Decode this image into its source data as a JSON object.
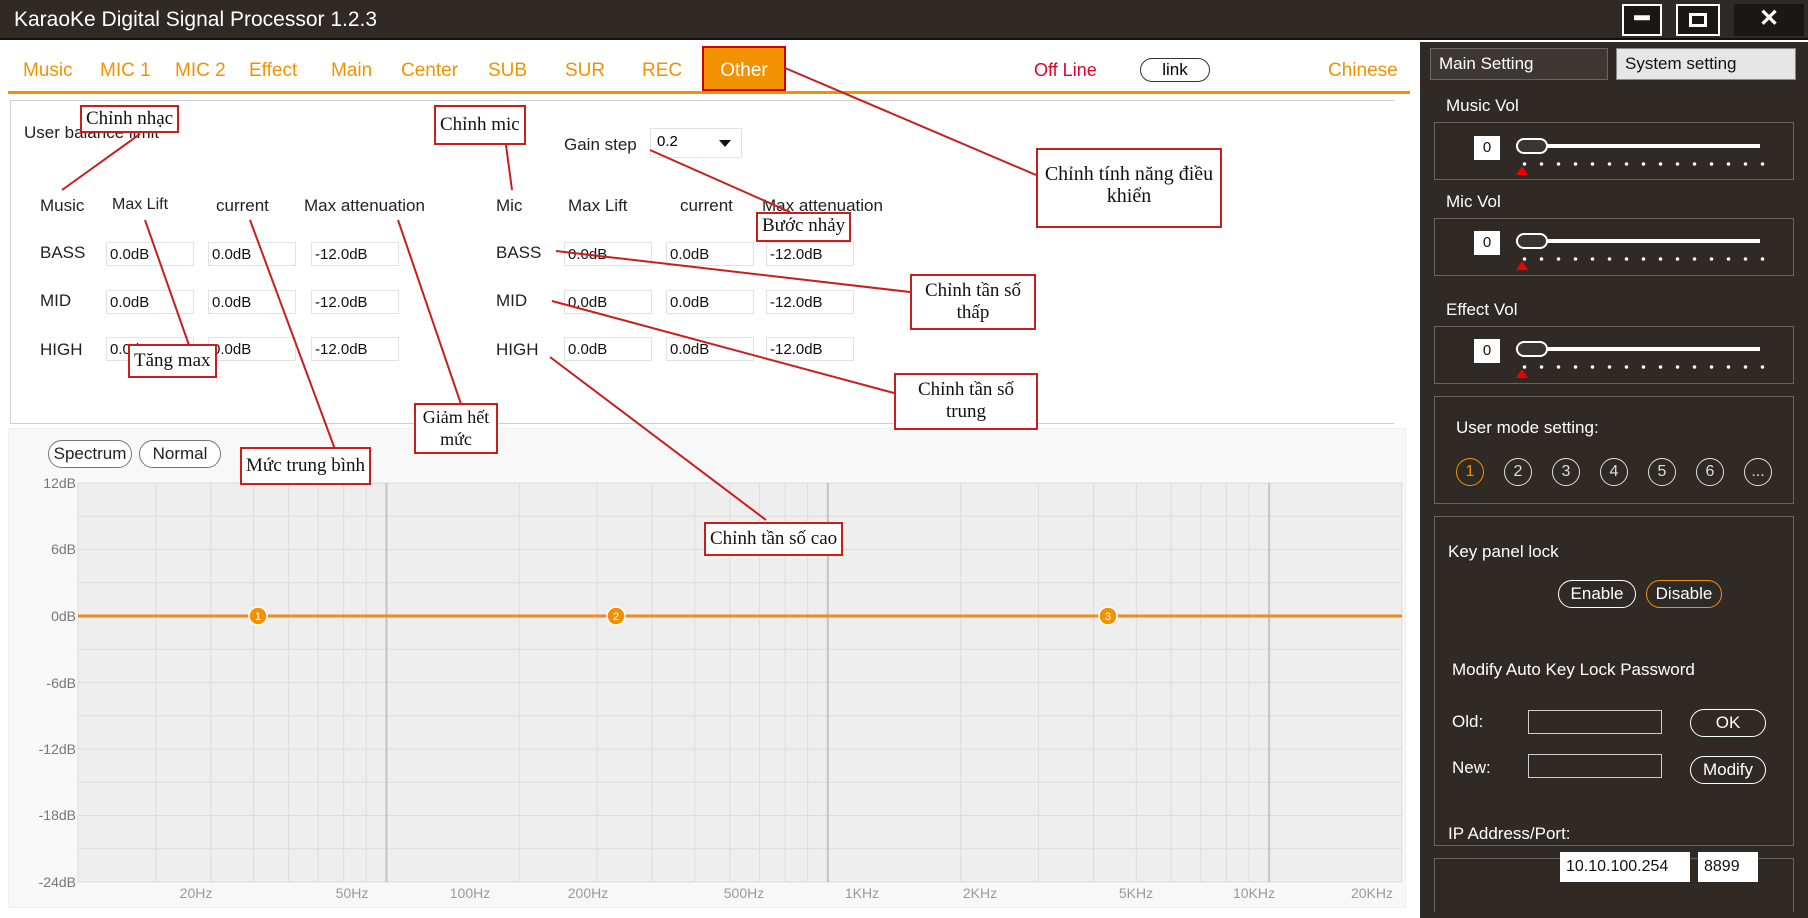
{
  "window": {
    "title": "KaraoKe Digital Signal Processor 1.2.3"
  },
  "tabs": [
    "Music",
    "MIC 1",
    "MIC 2",
    "Effect",
    "Main",
    "Center",
    "SUB",
    "SUR",
    "REC",
    "Other"
  ],
  "active_tab": "Other",
  "status": {
    "offline": "Off Line",
    "link": "link",
    "language": "Chinese"
  },
  "panel": {
    "title": "User balance limit",
    "gain_step_label": "Gain step",
    "gain_step_value": "0.2",
    "music": {
      "headers": [
        "Music",
        "Max Lift",
        "current",
        "Max attenuation"
      ],
      "rows": [
        {
          "name": "BASS",
          "max_lift": "0.0dB",
          "current": "0.0dB",
          "max_att": "-12.0dB"
        },
        {
          "name": "MID",
          "max_lift": "0.0dB",
          "current": "0.0dB",
          "max_att": "-12.0dB"
        },
        {
          "name": "HIGH",
          "max_lift": "0.0dB",
          "current": "0.0dB",
          "max_att": "-12.0dB"
        }
      ]
    },
    "mic": {
      "headers": [
        "Mic",
        "Max Lift",
        "current",
        "Max attenuation"
      ],
      "rows": [
        {
          "name": "BASS",
          "max_lift": "0.0dB",
          "current": "0.0dB",
          "max_att": "-12.0dB"
        },
        {
          "name": "MID",
          "max_lift": "0.0dB",
          "current": "0.0dB",
          "max_att": "-12.0dB"
        },
        {
          "name": "HIGH",
          "max_lift": "0.0dB",
          "current": "0.0dB",
          "max_att": "-12.0dB"
        }
      ]
    }
  },
  "graph": {
    "buttons": [
      "Spectrum",
      "Normal"
    ],
    "y_labels": [
      "12dB",
      "6dB",
      "0dB",
      "-6dB",
      "-12dB",
      "-18dB",
      "-24dB"
    ],
    "x_labels": [
      "20Hz",
      "50Hz",
      "100Hz",
      "200Hz",
      "500Hz",
      "1KHz",
      "2KHz",
      "5KHz",
      "10KHz",
      "20KHz"
    ],
    "points": [
      {
        "label": "1",
        "gain_db": 0
      },
      {
        "label": "2",
        "gain_db": 0
      },
      {
        "label": "3",
        "gain_db": 0
      }
    ],
    "line_color": "#f28a1e"
  },
  "right": {
    "tabs": [
      "Main Setting",
      "System setting"
    ],
    "music_vol": {
      "label": "Music Vol",
      "value": "0"
    },
    "mic_vol": {
      "label": "Mic Vol",
      "value": "0"
    },
    "effect_vol": {
      "label": "Effect Vol",
      "value": "0"
    },
    "user_mode": {
      "label": "User mode setting:",
      "modes": [
        "1",
        "2",
        "3",
        "4",
        "5",
        "6",
        "..."
      ]
    },
    "key_lock": {
      "label": "Key panel lock",
      "enable": "Enable",
      "disable": "Disable"
    },
    "password": {
      "label": "Modify Auto Key Lock Password",
      "old": "Old:",
      "new": "New:",
      "ok": "OK",
      "modify": "Modify"
    },
    "ip": {
      "label": "IP Address/Port:",
      "address": "10.10.100.254",
      "port": "8899"
    }
  },
  "annotations": {
    "chinh_nhac": "Chỉnh nhạc",
    "chinh_mic": "Chỉnh mic",
    "tang_max": "Tăng max",
    "muc_trung_binh": "Mức trung bình",
    "giam_het_muc": "Giảm hết mức",
    "buoc_nhay": "Bước nhảy",
    "chinh_tinh_nang": "Chỉnh tính năng điều khiển",
    "tan_so_thap": "Chỉnh tần số thấp",
    "tan_so_trung": "Chỉnh tần số trung",
    "tan_so_cao": "Chỉnh tần số cao"
  },
  "colors": {
    "accent": "#f29200",
    "annotation": "#c81e1e",
    "sidebar_bg": "#2f2a26"
  }
}
